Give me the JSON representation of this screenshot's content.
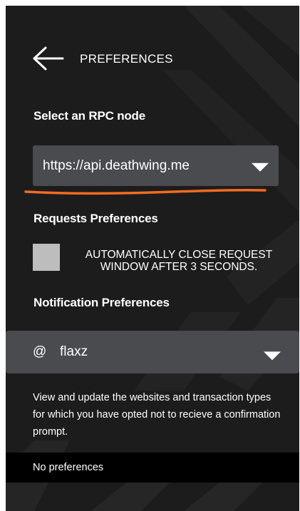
{
  "header": {
    "title": "PREFERENCES",
    "back_icon": "arrow-left-icon"
  },
  "rpc": {
    "label": "Select an RPC node",
    "selected": "https://api.deathwing.me"
  },
  "requests": {
    "label": "Requests Preferences",
    "checkbox_label": "AUTOMATICALLY CLOSE REQUEST WINDOW AFTER 3 SECONDS.",
    "checked": false
  },
  "notifications": {
    "label": "Notification Preferences",
    "account_prefix": "@",
    "account": "flaxz",
    "description": "View and update the websites and transaction types for which you have opted not to recieve a confirmation prompt.",
    "empty_text": "No preferences"
  },
  "colors": {
    "background": "#1c1c1c",
    "field": "#4a4b4f",
    "annotation": "#f36b21"
  }
}
